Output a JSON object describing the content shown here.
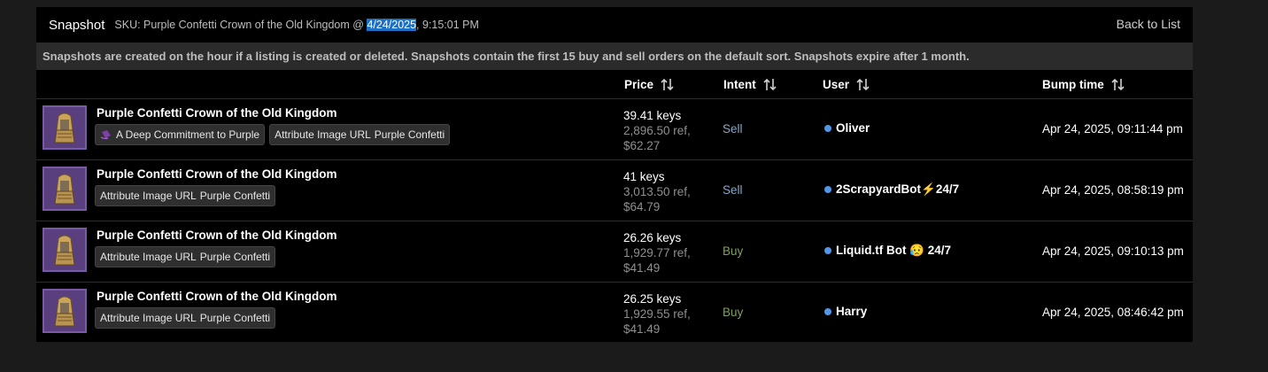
{
  "header": {
    "title": "Snapshot",
    "sku_prefix": "SKU: Purple Confetti Crown of the Old Kingdom @ ",
    "sku_date": "4/24/2025",
    "sku_time": ", 9:15:01 PM",
    "back_label": "Back to List"
  },
  "notice": "Snapshots are created on the hour if a listing is created or deleted. Snapshots contain the first 15 buy and sell orders on the default sort. Snapshots expire after 1 month.",
  "columns": {
    "price": "Price",
    "intent": "Intent",
    "user": "User",
    "bump": "Bump time"
  },
  "colors": {
    "sell": "#8aa5c8",
    "buy": "#7aa060",
    "status_dot": "#4f97e8",
    "thumb_bg": "#5a3f7f"
  },
  "rows": [
    {
      "name": "Purple Confetti Crown of the Old Kingdom",
      "tag_paint": "A Deep Commitment to Purple",
      "tag_attr_label": "Attribute Image URL",
      "tag_attr_value": "Purple Confetti",
      "price_keys": "39.41 keys",
      "price_ref": "2,896.50 ref,",
      "price_usd": "$62.27",
      "intent": "Sell",
      "user": "Oliver",
      "bump": "Apr 24, 2025, 09:11:44 pm"
    },
    {
      "name": "Purple Confetti Crown of the Old Kingdom",
      "tag_attr_label": "Attribute Image URL",
      "tag_attr_value": "Purple Confetti",
      "price_keys": "41 keys",
      "price_ref": "3,013.50 ref,",
      "price_usd": "$64.79",
      "intent": "Sell",
      "user": "2ScrapyardBot⚡24/7",
      "bump": "Apr 24, 2025, 08:58:19 pm"
    },
    {
      "name": "Purple Confetti Crown of the Old Kingdom",
      "tag_attr_label": "Attribute Image URL",
      "tag_attr_value": "Purple Confetti",
      "price_keys": "26.26 keys",
      "price_ref": "1,929.77 ref,",
      "price_usd": "$41.49",
      "intent": "Buy",
      "user": "Liquid.tf Bot 😥 24/7",
      "bump": "Apr 24, 2025, 09:10:13 pm"
    },
    {
      "name": "Purple Confetti Crown of the Old Kingdom",
      "tag_attr_label": "Attribute Image URL",
      "tag_attr_value": "Purple Confetti",
      "price_keys": "26.25 keys",
      "price_ref": "1,929.55 ref,",
      "price_usd": "$41.49",
      "intent": "Buy",
      "user": "Harry",
      "bump": "Apr 24, 2025, 08:46:42 pm"
    }
  ]
}
